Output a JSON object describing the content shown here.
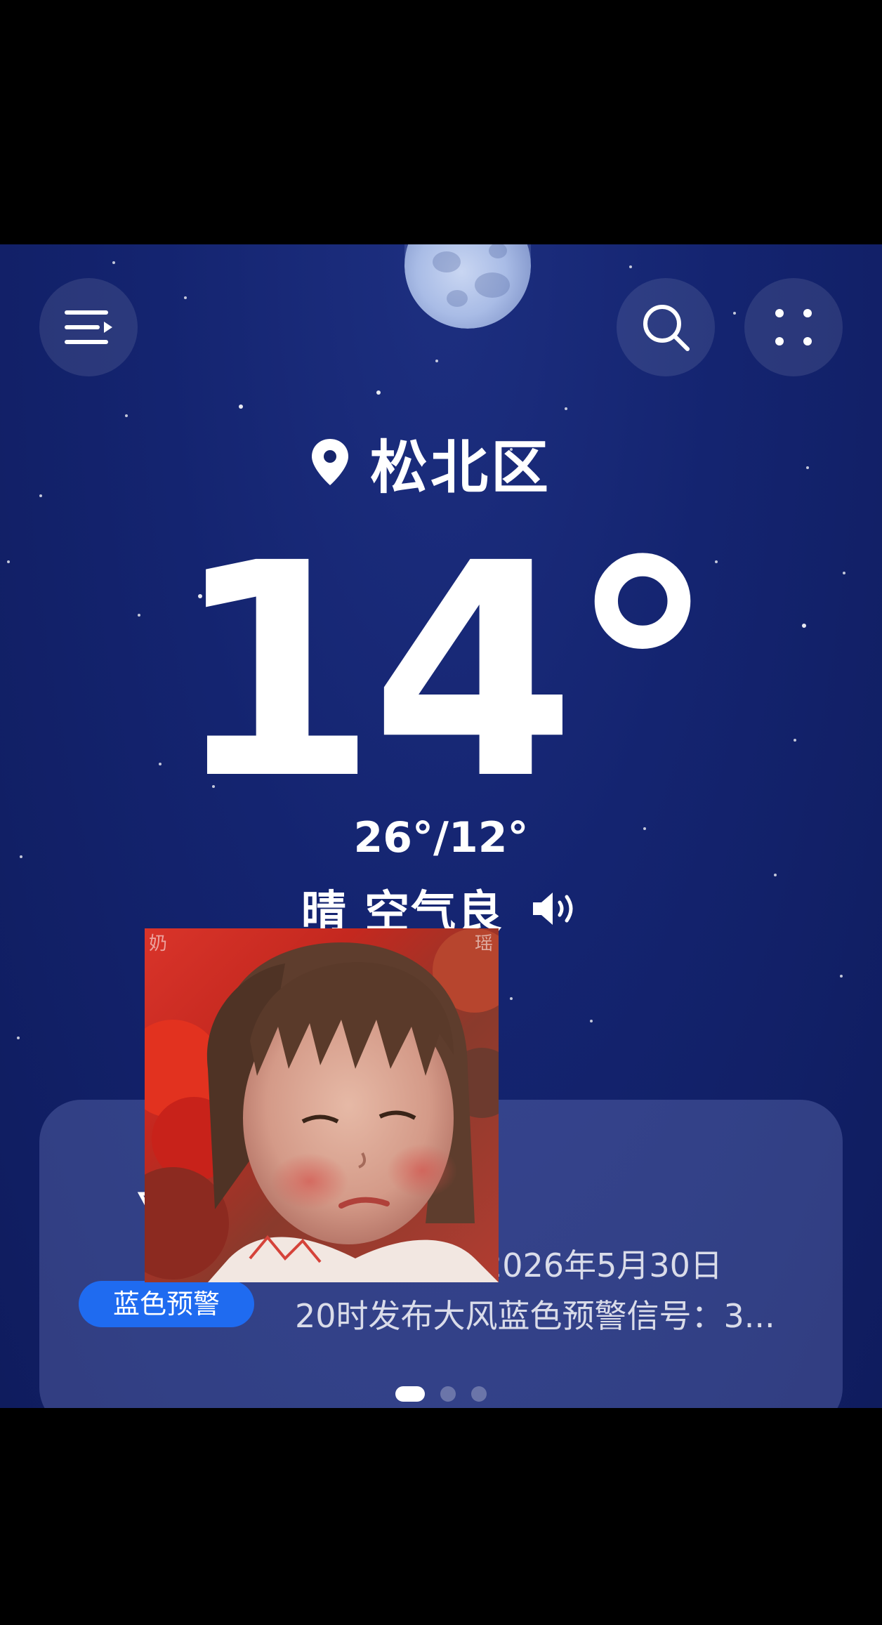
{
  "header": {
    "menu_icon": "menu-icon",
    "search_icon": "search-icon",
    "more_icon": "grid-dots-icon"
  },
  "location": {
    "icon": "location-pin-icon",
    "name": "松北区"
  },
  "weather": {
    "temperature": "14°",
    "high_low": "26°/12°",
    "condition": "晴 空气良",
    "speaker_icon": "speaker-icon"
  },
  "alert": {
    "title_visible": "警",
    "line1": "台2026年5月30日",
    "line2": "20时发布大风蓝色预警信号：3...",
    "badge": "蓝色预警",
    "badge_color": "#1f6bf0",
    "page_indicator": {
      "total": 3,
      "active": 1
    }
  },
  "overlay_photo": {
    "description_icon": "child-portrait-photo",
    "watermark_left": "奶",
    "watermark_right": "瑶"
  }
}
